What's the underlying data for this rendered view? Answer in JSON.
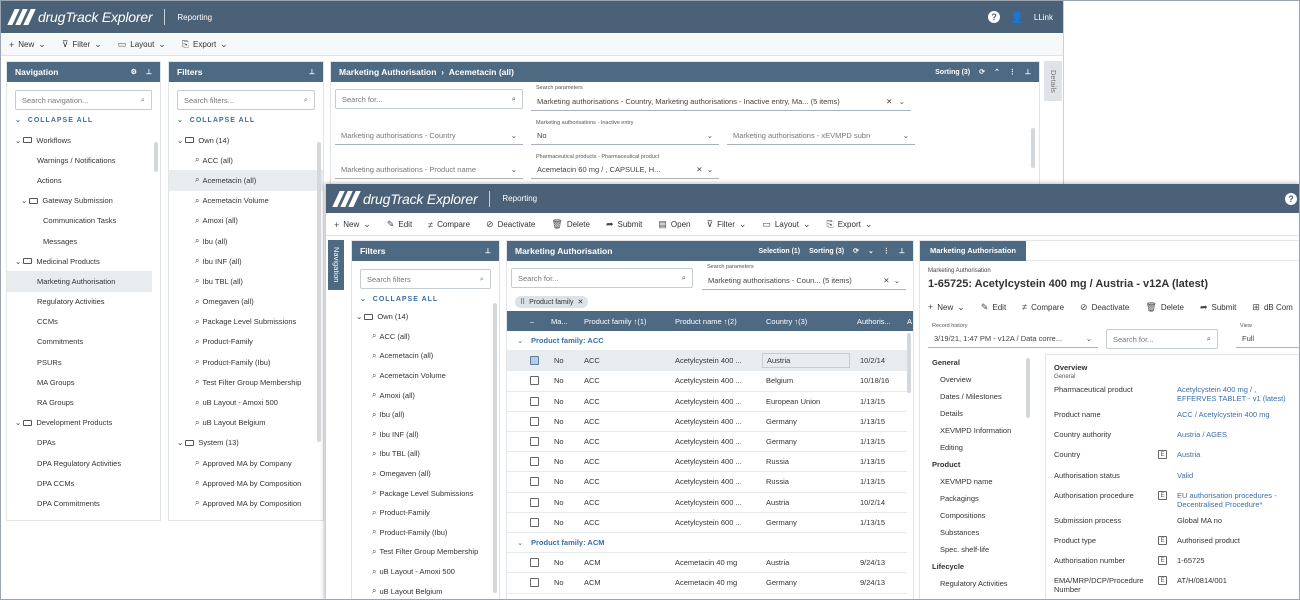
{
  "app": {
    "name": "drugTrack Explorer",
    "module": "Reporting",
    "user": "LLink",
    "help_icon": "?"
  },
  "back": {
    "toolbar": {
      "new": "New",
      "filter": "Filter",
      "layout": "Layout",
      "export": "Export"
    },
    "navigation": {
      "title": "Navigation",
      "search_placeholder": "Search navigation...",
      "collapse_all": "COLLAPSE ALL",
      "items": [
        "Workflows",
        "Warnings / Notifications",
        "Actions",
        "Gateway Submission",
        "Communication Tasks",
        "Messages",
        "Medicinal Products",
        "Marketing Authorisation",
        "Regulatory Activities",
        "CCMs",
        "Commitments",
        "PSURs",
        "MA Groups",
        "RA Groups",
        "Development Products",
        "DPAs",
        "DPA Regulatory Activities",
        "DPA CCMs",
        "DPA Commitments"
      ]
    },
    "filters": {
      "title": "Filters",
      "search_placeholder": "Search filters...",
      "collapse_all": "COLLAPSE ALL",
      "own_group": "Own (14)",
      "own_items": [
        "ACC (all)",
        "Acemetacin (all)",
        "Acemetacin Volume",
        "Amoxi (all)",
        "Ibu (all)",
        "Ibu INF (all)",
        "Ibu TBL (all)",
        "Omegaven (all)",
        "Package Level Submissions",
        "Product-Family",
        "Product-Family (Ibu)",
        "Test Filter Group Membership",
        "uB Layout - Amoxi 500",
        "uB Layout Belgium"
      ],
      "system_group": "System (13)",
      "system_items": [
        "Approved MA by Company",
        "Approved MA by Composition",
        "Approved MA by Composition"
      ]
    },
    "main": {
      "breadcrumb_root": "Marketing Authorisation",
      "breadcrumb_sep": "›",
      "breadcrumb_leaf": "Acemetacin (all)",
      "sorting": "Sorting (3)",
      "details_tab": "Details",
      "search_placeholder": "Search for...",
      "search_params_label": "Search parameters",
      "search_params_value": "Marketing authorisations - Country, Marketing authorisations - Inactive entry, Ma... (5 items)",
      "country_field": "Marketing authorisations - Country",
      "inactive_label": "Marketing authorisations - Inactive entry",
      "inactive_value": "No",
      "xevmpd_field": "Marketing authorisations - xEVMPD subn",
      "product_name_field": "Marketing authorisations - Product name",
      "pharma_label": "Pharmaceutical products - Pharmaceutical product",
      "pharma_value": "Acemetacin 60 mg / , CAPSULE, H..."
    }
  },
  "front": {
    "toolbar": {
      "new": "New",
      "edit": "Edit",
      "compare": "Compare",
      "deactivate": "Deactivate",
      "delete": "Delete",
      "submit": "Submit",
      "open": "Open",
      "filter": "Filter",
      "layout": "Layout",
      "export": "Export"
    },
    "nav_tab": "Navigation",
    "filters": {
      "title": "Filters",
      "search_placeholder": "Search filters",
      "collapse_all": "COLLAPSE ALL",
      "own_group": "Own (14)",
      "own_items": [
        "ACC (all)",
        "Acemetacin (all)",
        "Acemetacin Volume",
        "Amoxi (all)",
        "Ibu (all)",
        "Ibu INF (all)",
        "Ibu TBL (all)",
        "Omegaven (all)",
        "Package Level Submissions",
        "Product-Family",
        "Product-Family (Ibu)",
        "Test Filter Group Membership",
        "uB Layout - Amoxi 500",
        "uB Layout Belgium"
      ]
    },
    "grid": {
      "title": "Marketing Authorisation",
      "selection": "Selection (1)",
      "sorting": "Sorting (3)",
      "search_placeholder": "Search for...",
      "search_params_label": "Search parameters",
      "search_params_value": "Marketing authorisations - Coun... (5 items)",
      "chip": "Product family",
      "columns": [
        "–",
        "Ma...",
        "Product family ↑(1)",
        "Product name ↑(2)",
        "Country ↑(3)",
        "Authoris...",
        "A"
      ],
      "group1": "Product family: ACC",
      "group2": "Product family: ACM",
      "rows_acc": [
        [
          "No",
          "ACC",
          "Acetylcystein 400 ...",
          "Austria",
          "10/2/14"
        ],
        [
          "No",
          "ACC",
          "Acetylcystein 400 ...",
          "Belgium",
          "10/18/16"
        ],
        [
          "No",
          "ACC",
          "Acetylcystein 400 ...",
          "European Union",
          "1/13/15"
        ],
        [
          "No",
          "ACC",
          "Acetylcystein 400 ...",
          "Germany",
          "1/13/15"
        ],
        [
          "No",
          "ACC",
          "Acetylcystein 400 ...",
          "Germany",
          "1/13/15"
        ],
        [
          "No",
          "ACC",
          "Acetylcystein 400 ...",
          "Russia",
          "1/13/15"
        ],
        [
          "No",
          "ACC",
          "Acetylcystein 400 ...",
          "Russia",
          "1/13/15"
        ],
        [
          "No",
          "ACC",
          "Acetylcystein 600 ...",
          "Austria",
          "10/2/14"
        ],
        [
          "No",
          "ACC",
          "Acetylcystein 600 ...",
          "Germany",
          "1/13/15"
        ]
      ],
      "rows_acm": [
        [
          "No",
          "ACM",
          "Acemetacin 40 mg",
          "Austria",
          "9/24/13"
        ],
        [
          "No",
          "ACM",
          "Acemetacin 40 mg",
          "Germany",
          "9/24/13"
        ]
      ]
    },
    "detail": {
      "tab": "Marketing Authorisation",
      "kind": "Marketing Authorisation",
      "title": "1-65725: Acetylcystein 400 mg / Austria - v12A (latest)",
      "toolbar": {
        "new": "New",
        "edit": "Edit",
        "compare": "Compare",
        "deactivate": "Deactivate",
        "delete": "Delete",
        "submit": "Submit",
        "dbcomp": "dB Com"
      },
      "record_history_label": "Record history",
      "record_history_value": "3/19/21, 1:47 PM - v12A / Data corre...",
      "search_placeholder": "Search for...",
      "view_label": "View",
      "view_value": "Full",
      "side": {
        "general": "General",
        "general_items": [
          "Overview",
          "Dates / Milestones",
          "Details",
          "XEVMPD Information",
          "Editing"
        ],
        "product": "Product",
        "product_items": [
          "XEVMPD name",
          "Packagings",
          "Compositions",
          "Substances",
          "Spec. shelf-life"
        ],
        "lifecycle": "Lifecycle",
        "lifecycle_items": [
          "Regulatory Activities"
        ]
      },
      "overview_title": "Overview",
      "overview_sub": "General",
      "fields": [
        {
          "label": "Pharmaceutical product",
          "value": "Acetylcystein 400 mg / , EFFERVES TABLET - v1 (latest)",
          "link": true,
          "icon": false
        },
        {
          "label": "Product name",
          "value": "ACC / Acetylcystein 400 mg",
          "link": true,
          "icon": false
        },
        {
          "label": "Country authority",
          "value": "Austria / AGES",
          "link": true,
          "icon": false
        },
        {
          "label": "Country",
          "value": "Austria",
          "link": true,
          "icon": true
        },
        {
          "label": "Authorisation status",
          "value": "Valid",
          "link": true,
          "icon": false
        },
        {
          "label": "Authorisation procedure",
          "value": "EU authorisation procedures - Decentralised Procedure*",
          "link": true,
          "icon": true
        },
        {
          "label": "Submission process",
          "value": "Global MA no",
          "link": false,
          "icon": false
        },
        {
          "label": "Product type",
          "value": "Authorised product",
          "link": false,
          "icon": true
        },
        {
          "label": "Authorisation number",
          "value": "1-65725",
          "link": false,
          "icon": true
        },
        {
          "label": "EMA/MRP/DCP/Procedure Number",
          "value": "AT/H/0814/001",
          "link": false,
          "icon": true
        }
      ]
    }
  },
  "colors": {
    "header": "#4a6178",
    "pane_header": "#4e6a82",
    "accent": "#3b6ea5"
  }
}
